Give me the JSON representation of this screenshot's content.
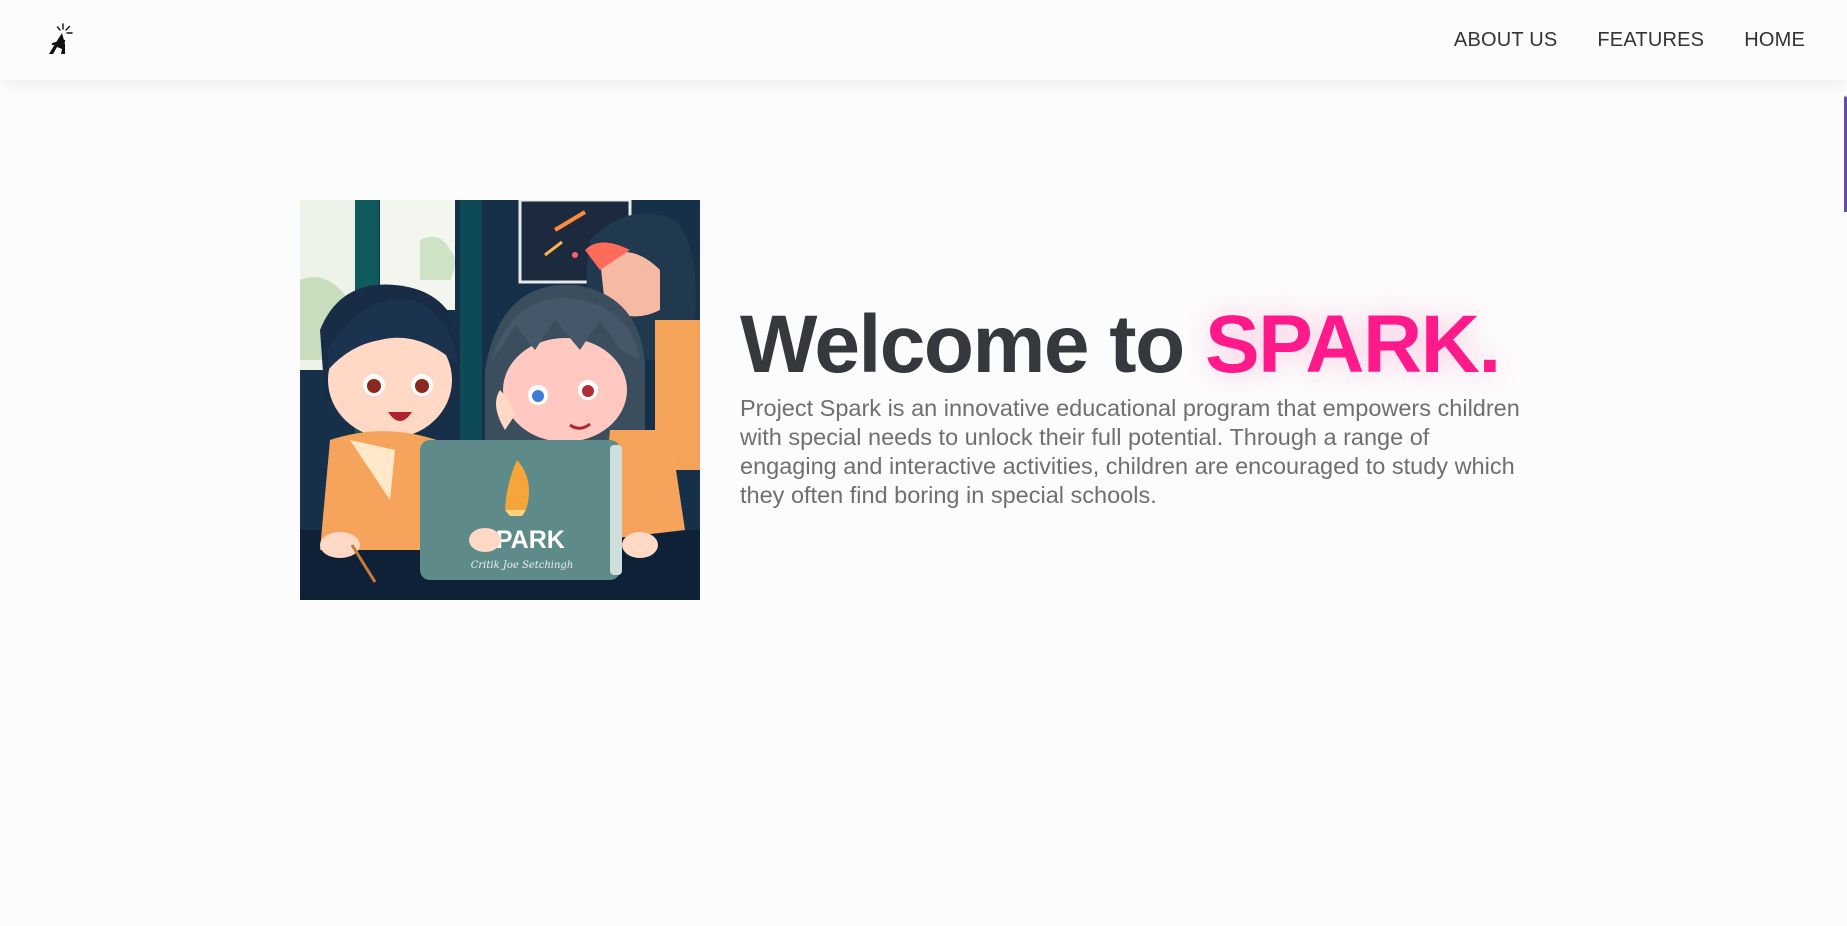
{
  "header": {
    "logo_icon": "spark-logo-icon",
    "nav": [
      {
        "label": "ABOUT US"
      },
      {
        "label": "FEATURES"
      },
      {
        "label": "HOME"
      }
    ]
  },
  "hero": {
    "image_icon": "children-laptop-illustration",
    "image_laptop_label": "SPARK",
    "image_laptop_subtitle": "Critik Joe Setchingh",
    "title_prefix": "Welcome to ",
    "title_brand": "SPARK.",
    "description": "Project Spark is an innovative educational program that empowers children with special needs to unlock their full potential. Through a range of engaging and interactive activities, children are encouraged to study which they often find boring in special schools."
  },
  "colors": {
    "background": "#fcfcfc",
    "title": "#35383c",
    "brand_accent": "#ff1a8c",
    "body_text": "#6f6f6f",
    "nav_text": "#333333"
  }
}
